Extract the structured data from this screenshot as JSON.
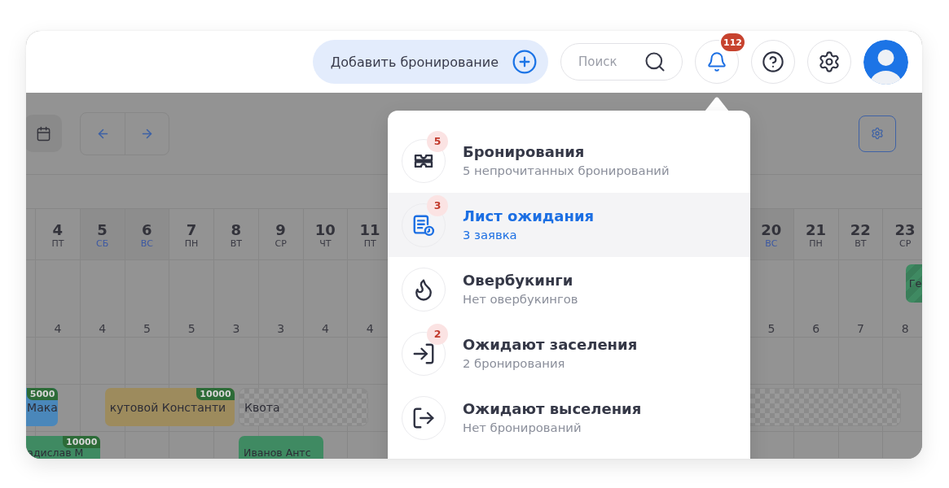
{
  "header": {
    "add_booking": {
      "label": "Добавить бронирование"
    },
    "search": {
      "placeholder": "Поиск"
    },
    "notifications": {
      "badge": "112",
      "active": true
    }
  },
  "calendar": {
    "days": [
      {
        "day": "4",
        "weekday": "ПТ",
        "weekend": false,
        "count": "4"
      },
      {
        "day": "5",
        "weekday": "СБ",
        "weekend": true,
        "count": "4"
      },
      {
        "day": "6",
        "weekday": "ВС",
        "weekend": true,
        "count": "5"
      },
      {
        "day": "7",
        "weekday": "ПН",
        "weekend": false,
        "count": "5"
      },
      {
        "day": "8",
        "weekday": "ВТ",
        "weekend": false,
        "count": "3"
      },
      {
        "day": "9",
        "weekday": "СР",
        "weekend": false,
        "count": "3"
      },
      {
        "day": "10",
        "weekday": "ЧТ",
        "weekend": false,
        "count": "4"
      },
      {
        "day": "11",
        "weekday": "ПТ",
        "weekend": false,
        "count": "4"
      },
      {
        "day": "20",
        "weekday": "ВС",
        "weekend": true,
        "count": "5"
      },
      {
        "day": "21",
        "weekday": "ПН",
        "weekend": false,
        "count": "6"
      },
      {
        "day": "22",
        "weekday": "ВТ",
        "weekend": false,
        "count": "7"
      },
      {
        "day": "23",
        "weekday": "СР",
        "weekend": false,
        "count": "8"
      }
    ],
    "bookings": [
      {
        "kind": "guest",
        "name": "Ге",
        "color": "#3f8a62",
        "striped": true
      },
      {
        "kind": "guest",
        "name": "Мака",
        "price": "5000",
        "color": "#4a87ba",
        "striped": false
      },
      {
        "kind": "guest",
        "name": "кутовой Константи",
        "price": "10000",
        "color": "#9d8b5d",
        "striped": false
      },
      {
        "kind": "quota",
        "name": "Квота"
      },
      {
        "kind": "quota"
      },
      {
        "kind": "guest",
        "name": "адислав М",
        "price": "10000",
        "color": "#3f8a62",
        "striped": false
      },
      {
        "kind": "guest",
        "name": "Иванов Антс",
        "color": "#3f8a62",
        "striped": false
      }
    ]
  },
  "notifications_menu": {
    "items": [
      {
        "title": "Бронирования",
        "subtitle": "5 непрочитанных бронирований",
        "badge": "5",
        "selected": false
      },
      {
        "title": "Лист ожидания",
        "subtitle": "3 заявка",
        "badge": "3",
        "selected": true
      },
      {
        "title": "Овербукинги",
        "subtitle": "Нет овербукингов",
        "selected": false
      },
      {
        "title": "Ожидают заселения",
        "subtitle": "2 бронирования",
        "badge": "2",
        "selected": false
      },
      {
        "title": "Ожидают выселения",
        "subtitle": "Нет бронирований",
        "selected": false
      }
    ]
  }
}
